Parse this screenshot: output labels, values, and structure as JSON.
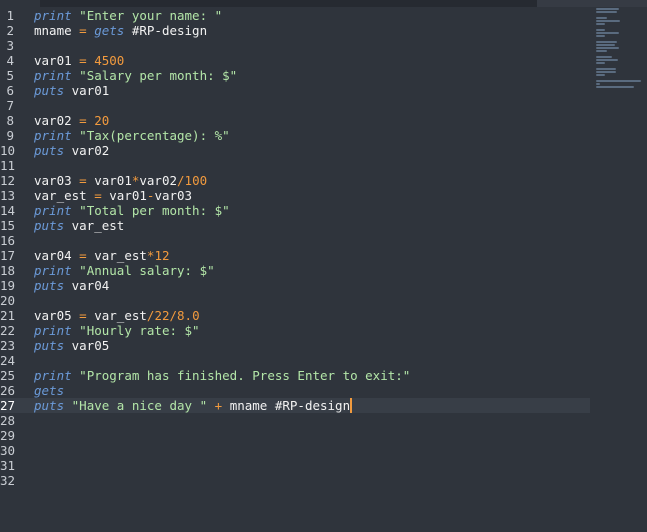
{
  "editor": {
    "active_line": 27,
    "lines": [
      [
        {
          "t": "print",
          "c": "kw"
        },
        {
          "t": " ",
          "c": "plain"
        },
        {
          "t": "\"Enter your name: \"",
          "c": "str"
        }
      ],
      [
        {
          "t": "mname ",
          "c": "plain"
        },
        {
          "t": "=",
          "c": "op"
        },
        {
          "t": " ",
          "c": "plain"
        },
        {
          "t": "gets",
          "c": "kw"
        },
        {
          "t": " #RP-design",
          "c": "plain"
        }
      ],
      [],
      [
        {
          "t": "var01 ",
          "c": "plain"
        },
        {
          "t": "=",
          "c": "op"
        },
        {
          "t": " ",
          "c": "plain"
        },
        {
          "t": "4500",
          "c": "num"
        }
      ],
      [
        {
          "t": "print",
          "c": "kw"
        },
        {
          "t": " ",
          "c": "plain"
        },
        {
          "t": "\"Salary per month: $\"",
          "c": "str"
        }
      ],
      [
        {
          "t": "puts",
          "c": "kw"
        },
        {
          "t": " var01",
          "c": "plain"
        }
      ],
      [],
      [
        {
          "t": "var02 ",
          "c": "plain"
        },
        {
          "t": "=",
          "c": "op"
        },
        {
          "t": " ",
          "c": "plain"
        },
        {
          "t": "20",
          "c": "num"
        }
      ],
      [
        {
          "t": "print",
          "c": "kw"
        },
        {
          "t": " ",
          "c": "plain"
        },
        {
          "t": "\"Tax(percentage): %\"",
          "c": "str"
        }
      ],
      [
        {
          "t": "puts",
          "c": "kw"
        },
        {
          "t": " var02",
          "c": "plain"
        }
      ],
      [],
      [
        {
          "t": "var03 ",
          "c": "plain"
        },
        {
          "t": "=",
          "c": "op"
        },
        {
          "t": " var01",
          "c": "plain"
        },
        {
          "t": "*",
          "c": "op"
        },
        {
          "t": "var02",
          "c": "plain"
        },
        {
          "t": "/",
          "c": "op"
        },
        {
          "t": "100",
          "c": "num"
        }
      ],
      [
        {
          "t": "var_est ",
          "c": "plain"
        },
        {
          "t": "=",
          "c": "op"
        },
        {
          "t": " var01",
          "c": "plain"
        },
        {
          "t": "-",
          "c": "op"
        },
        {
          "t": "var03",
          "c": "plain"
        }
      ],
      [
        {
          "t": "print",
          "c": "kw"
        },
        {
          "t": " ",
          "c": "plain"
        },
        {
          "t": "\"Total per month: $\"",
          "c": "str"
        }
      ],
      [
        {
          "t": "puts",
          "c": "kw"
        },
        {
          "t": " var_est",
          "c": "plain"
        }
      ],
      [],
      [
        {
          "t": "var04 ",
          "c": "plain"
        },
        {
          "t": "=",
          "c": "op"
        },
        {
          "t": " var_est",
          "c": "plain"
        },
        {
          "t": "*",
          "c": "op"
        },
        {
          "t": "12",
          "c": "num"
        }
      ],
      [
        {
          "t": "print",
          "c": "kw"
        },
        {
          "t": " ",
          "c": "plain"
        },
        {
          "t": "\"Annual salary: $\"",
          "c": "str"
        }
      ],
      [
        {
          "t": "puts",
          "c": "kw"
        },
        {
          "t": " var04",
          "c": "plain"
        }
      ],
      [],
      [
        {
          "t": "var05 ",
          "c": "plain"
        },
        {
          "t": "=",
          "c": "op"
        },
        {
          "t": " var_est",
          "c": "plain"
        },
        {
          "t": "/",
          "c": "op"
        },
        {
          "t": "22",
          "c": "num"
        },
        {
          "t": "/",
          "c": "op"
        },
        {
          "t": "8.0",
          "c": "num"
        }
      ],
      [
        {
          "t": "print",
          "c": "kw"
        },
        {
          "t": " ",
          "c": "plain"
        },
        {
          "t": "\"Hourly rate: $\"",
          "c": "str"
        }
      ],
      [
        {
          "t": "puts",
          "c": "kw"
        },
        {
          "t": " var05",
          "c": "plain"
        }
      ],
      [],
      [
        {
          "t": "print",
          "c": "kw"
        },
        {
          "t": " ",
          "c": "plain"
        },
        {
          "t": "\"Program has finished. Press Enter to exit:\"",
          "c": "str"
        }
      ],
      [
        {
          "t": "gets",
          "c": "kw"
        }
      ],
      [
        {
          "t": "puts",
          "c": "kw"
        },
        {
          "t": " ",
          "c": "plain"
        },
        {
          "t": "\"Have a nice day \"",
          "c": "str"
        },
        {
          "t": " ",
          "c": "plain"
        },
        {
          "t": "+",
          "c": "op"
        },
        {
          "t": " mname #RP-design",
          "c": "plain"
        }
      ],
      [],
      [],
      [],
      [],
      []
    ]
  },
  "colors": {
    "background": "#2f343c",
    "keyword": "#6b9ad8",
    "string": "#b3e6a8",
    "number": "#f19a3e",
    "cursor": "#f19a3e"
  }
}
